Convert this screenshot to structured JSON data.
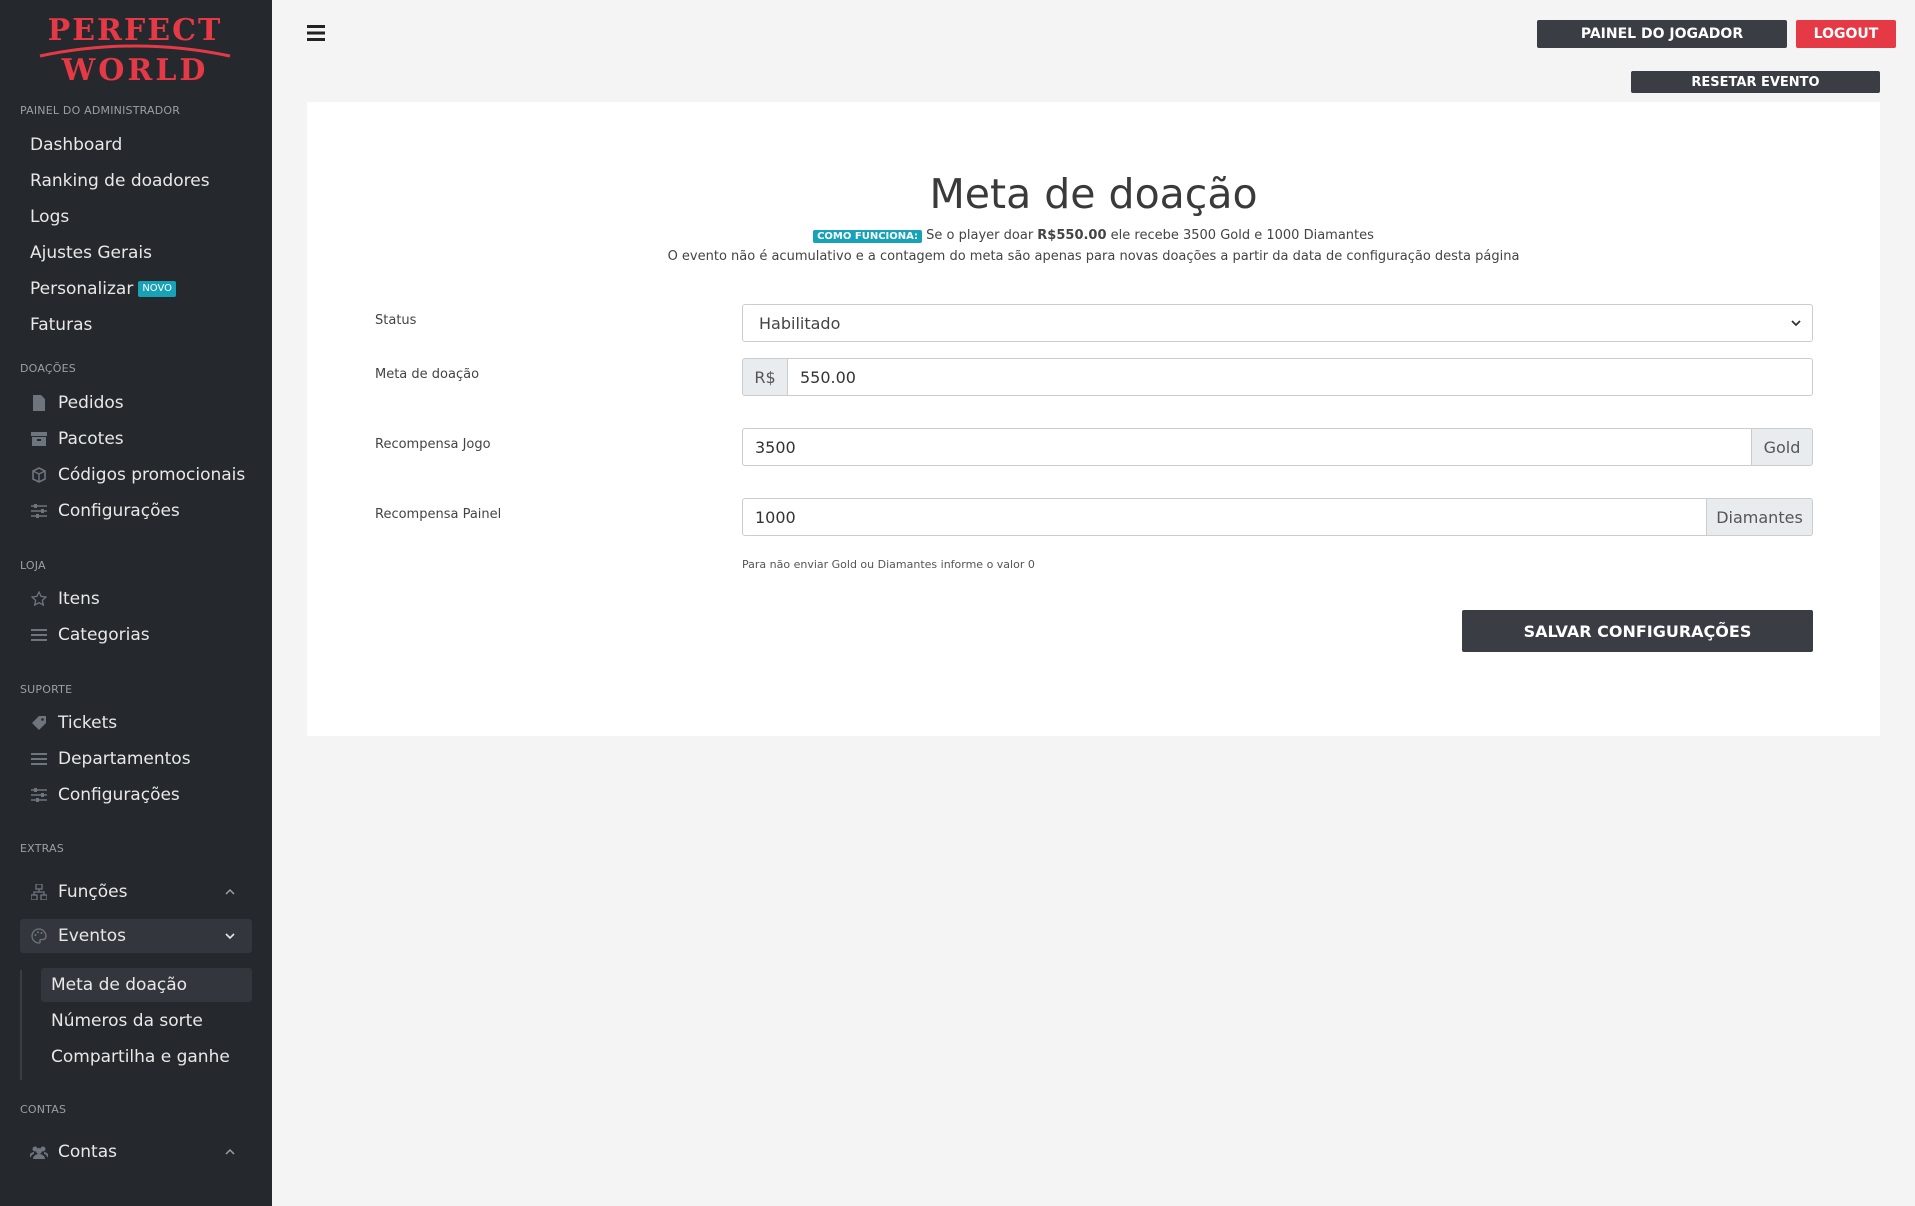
{
  "brand": {
    "line1": "PERFECT",
    "line2": "WORLD",
    "color": "#e63946"
  },
  "sidebar": {
    "sections": {
      "admin": "PAINEL DO ADMINISTRADOR",
      "doacoes": "DOAÇÕES",
      "loja": "LOJA",
      "suporte": "SUPORTE",
      "extras": "EXTRAS",
      "contas": "CONTAS"
    },
    "admin_items": [
      "Dashboard",
      "Ranking de doadores",
      "Logs",
      "Ajustes Gerais",
      "Personalizar",
      "Faturas"
    ],
    "personalizar_badge": "NOVO",
    "doacoes_items": [
      "Pedidos",
      "Pacotes",
      "Códigos promocionais",
      "Configurações"
    ],
    "loja_items": [
      "Itens",
      "Categorias"
    ],
    "suporte_items": [
      "Tickets",
      "Departamentos",
      "Configurações"
    ],
    "extras_items": [
      "Funções",
      "Eventos"
    ],
    "eventos_sub": [
      "Meta de doação",
      "Números da sorte",
      "Compartilha e ganhe"
    ],
    "contas_items": [
      "Contas"
    ]
  },
  "header": {
    "player_panel": "PAINEL DO JOGADOR",
    "logout": "LOGOUT",
    "reset_event": "RESETAR EVENTO"
  },
  "page": {
    "title": "Meta de doação",
    "info_badge": "COMO FUNCIONA:",
    "info_pre": " Se o player doar ",
    "info_amount": "R$550.00",
    "info_post": " ele recebe 3500 Gold e 1000 Diamantes",
    "info_line2": "O evento não é acumulativo e a contagem do meta são apenas para novas doações a partir da data de configuração desta página"
  },
  "form": {
    "status_label": "Status",
    "status_value": "Habilitado",
    "meta_label": "Meta de doação",
    "meta_prefix": "R$",
    "meta_value": "550.00",
    "jogo_label": "Recompensa Jogo",
    "jogo_value": "3500",
    "jogo_suffix": "Gold",
    "painel_label": "Recompensa Painel",
    "painel_value": "1000",
    "painel_suffix": "Diamantes",
    "hint": "Para não enviar Gold ou Diamantes informe o valor 0",
    "save": "SALVAR CONFIGURAÇÕES"
  }
}
